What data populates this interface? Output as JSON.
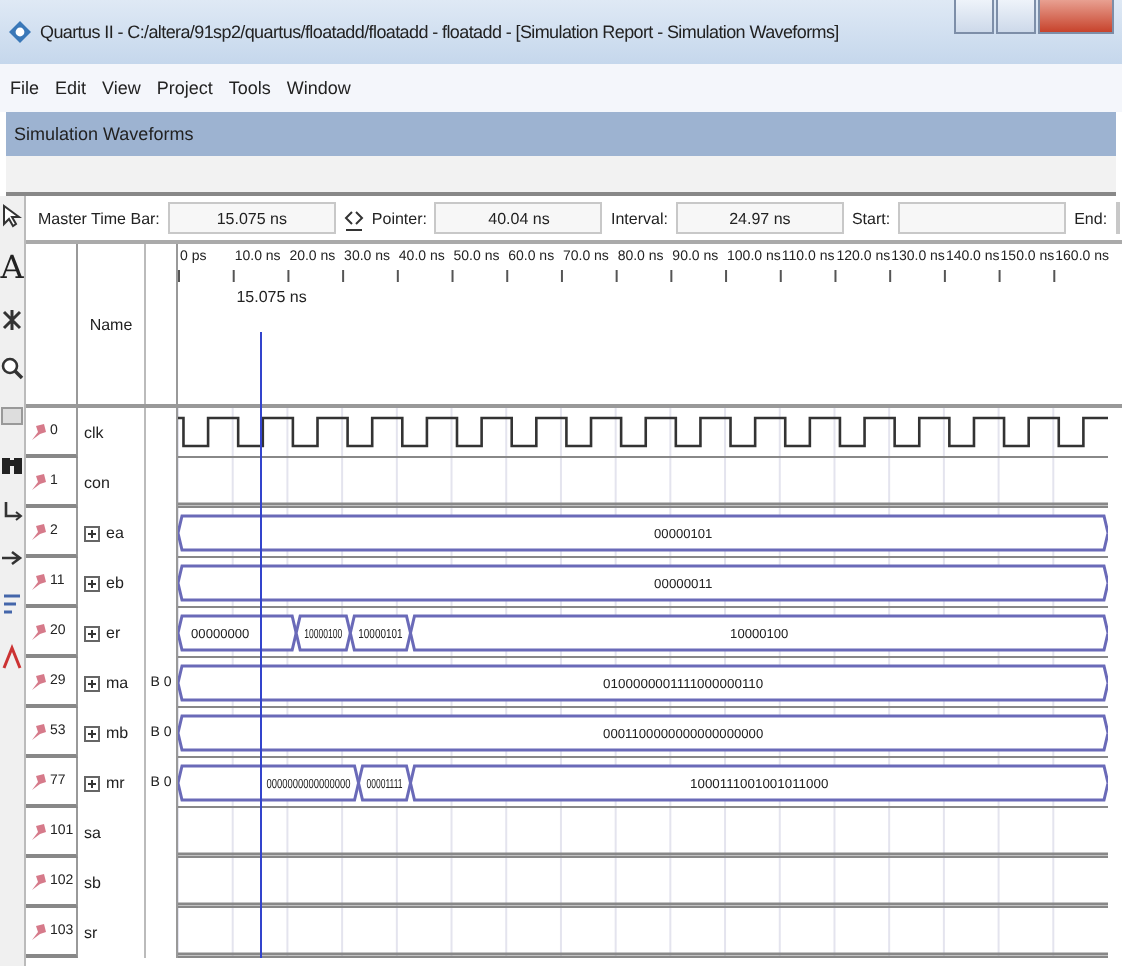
{
  "window": {
    "title": "Quartus II - C:/altera/91sp2/quartus/floatadd/floatadd - floatadd - [Simulation Report - Simulation Waveforms]"
  },
  "menu": [
    "File",
    "Edit",
    "View",
    "Project",
    "Tools",
    "Window"
  ],
  "panel": {
    "title": "Simulation Waveforms"
  },
  "tools": [
    {
      "kind": "pointer"
    },
    {
      "kind": "text",
      "label": "A"
    },
    {
      "kind": "node"
    },
    {
      "kind": "zoom"
    },
    {
      "kind": "fullscreen"
    },
    {
      "kind": "find"
    },
    {
      "kind": "replace"
    },
    {
      "kind": "arrow"
    },
    {
      "kind": "sort"
    },
    {
      "kind": "snap"
    }
  ],
  "time_bar": {
    "master_label": "Master Time Bar:",
    "master_value": "15.075 ns",
    "pointer_label": "Pointer:",
    "pointer_value": "40.04 ns",
    "interval_label": "Interval:",
    "interval_value": "24.97 ns",
    "start_label": "Start:",
    "end_label": "End:"
  },
  "header": {
    "name_label": "Name"
  },
  "ruler": [
    "0 ps",
    "10.0 ns",
    "20.0 ns",
    "30.0 ns",
    "40.0 ns",
    "50.0 ns",
    "60.0 ns",
    "70.0 ns",
    "80.0 ns",
    "90.0 ns",
    "100.0 ns",
    "110.0 ns",
    "120.0 ns",
    "130.0 ns",
    "140.0 ns",
    "150.0 ns",
    "160.0 ns"
  ],
  "cursor": {
    "label": "15.075 ns"
  },
  "signals": [
    {
      "id": "0",
      "name": "clk",
      "kind": "clock"
    },
    {
      "id": "1",
      "name": "con",
      "kind": "bit"
    },
    {
      "id": "2",
      "name": "ea",
      "kind": "bus",
      "expanded": false,
      "segments": [
        {
          "value": "00000101"
        }
      ]
    },
    {
      "id": "11",
      "name": "eb",
      "kind": "bus",
      "expanded": false,
      "segments": [
        {
          "value": "00000011"
        }
      ]
    },
    {
      "id": "20",
      "name": "er",
      "kind": "bus",
      "expanded": false,
      "segments": [
        {
          "value": "00000000"
        },
        {
          "value": "10000100"
        },
        {
          "value": "10000101"
        },
        {
          "value": "10000100"
        }
      ]
    },
    {
      "id": "29",
      "name": "ma",
      "kind": "bus",
      "expanded": false,
      "value": "B 0",
      "segments": [
        {
          "value": "0100000001111000000110"
        }
      ]
    },
    {
      "id": "53",
      "name": "mb",
      "kind": "bus",
      "expanded": false,
      "value": "B 0",
      "segments": [
        {
          "value": "0001100000000000000000"
        }
      ]
    },
    {
      "id": "77",
      "name": "mr",
      "kind": "bus",
      "expanded": false,
      "value": "B 0",
      "segments": [
        {
          "value": "0000000000000000"
        },
        {
          "value": "00001111"
        },
        {
          "value": "1000111001001011000"
        }
      ]
    },
    {
      "id": "101",
      "name": "sa",
      "kind": "bit"
    },
    {
      "id": "102",
      "name": "sb",
      "kind": "bit"
    },
    {
      "id": "103",
      "name": "sr",
      "kind": "bit"
    }
  ]
}
